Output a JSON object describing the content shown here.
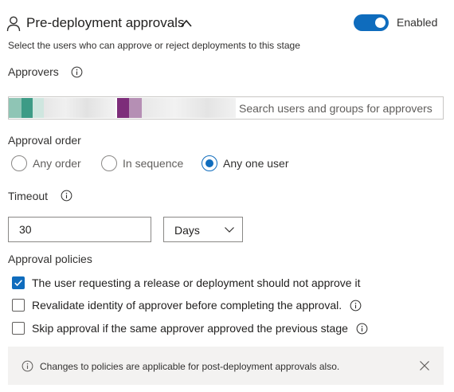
{
  "header": {
    "title": "Pre-deployment approvals",
    "toggle_label": "Enabled",
    "toggle_on": true,
    "subtitle": "Select the users who can approve or reject deployments to this stage",
    "person_icon": "person-icon",
    "collapse_icon": "chevron-up-icon"
  },
  "approvers": {
    "label": "Approvers",
    "info_icon": "info-icon",
    "search_placeholder": "Search users and groups for approvers"
  },
  "approval_order": {
    "label": "Approval order",
    "options": [
      "Any order",
      "In sequence",
      "Any one user"
    ],
    "selected": "Any one user"
  },
  "timeout": {
    "label": "Timeout",
    "info_icon": "info-icon",
    "value": "30",
    "unit": "Days"
  },
  "policies": {
    "label": "Approval policies",
    "items": [
      {
        "text": "The user requesting a release or deployment should not approve it",
        "checked": true,
        "has_info": false
      },
      {
        "text": "Revalidate identity of approver before completing the approval.",
        "checked": false,
        "has_info": true
      },
      {
        "text": "Skip approval if the same approver approved the previous stage",
        "checked": false,
        "has_info": true
      }
    ]
  },
  "info_bar": {
    "text": "Changes to policies are applicable for post-deployment approvals also.",
    "icon": "info-icon",
    "close_icon": "close-icon"
  },
  "colors": {
    "accent": "#0f6cbd",
    "info_bar_bg": "#f3f2f1"
  }
}
